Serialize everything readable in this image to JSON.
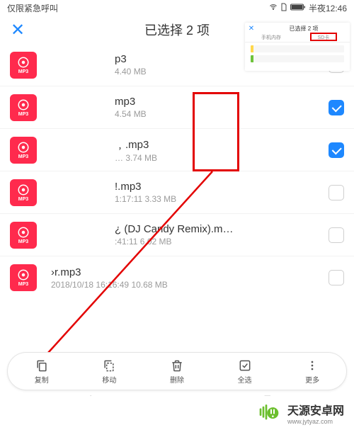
{
  "statusbar": {
    "left": "仅限紧急呼叫",
    "time": "半夜12:46"
  },
  "header": {
    "close_glyph": "✕",
    "title": "已选择 2 项"
  },
  "icon_tag": "MP3",
  "files": [
    {
      "name": "p3",
      "meta": "4.40 MB",
      "selected": false
    },
    {
      "name": "mp3",
      "meta": "4.54 MB",
      "selected": true
    },
    {
      "name": "﹐.mp3",
      "meta": "…  3.74 MB",
      "selected": true
    },
    {
      "name": "!.mp3",
      "meta": "1:17:11 3.33 MB",
      "selected": false
    },
    {
      "name": "¿ (DJ Candy Remix).m…",
      "meta": ":41:11 6.02 MB",
      "selected": false
    },
    {
      "name": "›r.mp3",
      "meta": "2018/10/18 16:16:49 10.68 MB",
      "selected": false
    }
  ],
  "toolbar": {
    "copy": "复制",
    "move": "移动",
    "delete": "删除",
    "selall": "全选",
    "more": "更多"
  },
  "inset": {
    "title": "已选择 2 项",
    "tab1": "手机内存",
    "tab2": "SD卡"
  },
  "brand": {
    "cn": "天源安卓网",
    "url": "www.jytyaz.com"
  },
  "colors": {
    "accent": "#1e88ff",
    "fileicon": "#ff2a4d",
    "anno": "#e30000",
    "brand": "#6cbf2e"
  }
}
